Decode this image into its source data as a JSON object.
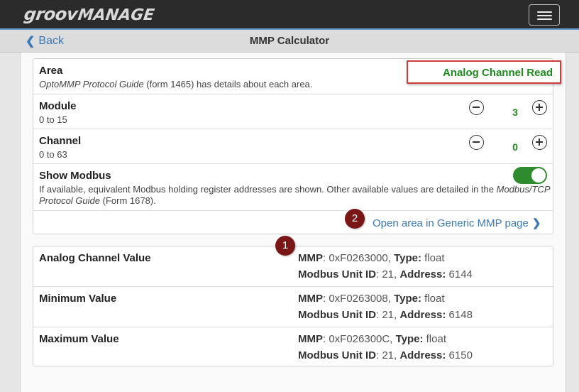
{
  "header": {
    "logo_part1": "groov",
    "logo_part2": "MANAGE"
  },
  "subheader": {
    "back_label": "Back",
    "title": "MMP Calculator"
  },
  "settings": {
    "area": {
      "title": "Area",
      "guide": "OptoMMP Protocol Guide",
      "guide_rest": " (form 1465) has details about each area.",
      "value": "Analog Channel Read"
    },
    "module": {
      "title": "Module",
      "range": "0 to 15",
      "value": "3"
    },
    "channel": {
      "title": "Channel",
      "range": "0 to 63",
      "value": "0"
    },
    "show_modbus": {
      "title": "Show Modbus",
      "desc_part1": "If available, equivalent Modbus holding register addresses are shown. Other available values are detailed in the ",
      "desc_guide": "Modbus/TCP Protocol Guide",
      "desc_part2": " (Form 1678).",
      "enabled": true
    },
    "open_link": "Open area in Generic MMP page"
  },
  "badges": [
    "1",
    "2"
  ],
  "labels": {
    "mmp": "MMP",
    "type": "Type:",
    "unit_id": "Modbus Unit ID",
    "address": "Address:"
  },
  "values": [
    {
      "name": "Analog Channel Value",
      "mmp": ": 0xF0263000, ",
      "type": " float",
      "unit": ": 21, ",
      "address": " 6144"
    },
    {
      "name": "Minimum Value",
      "mmp": ": 0xF0263008, ",
      "type": " float",
      "unit": ": 21, ",
      "address": " 6148"
    },
    {
      "name": "Maximum Value",
      "mmp": ": 0xF026300C, ",
      "type": " float",
      "unit": ": 21, ",
      "address": " 6150"
    }
  ]
}
